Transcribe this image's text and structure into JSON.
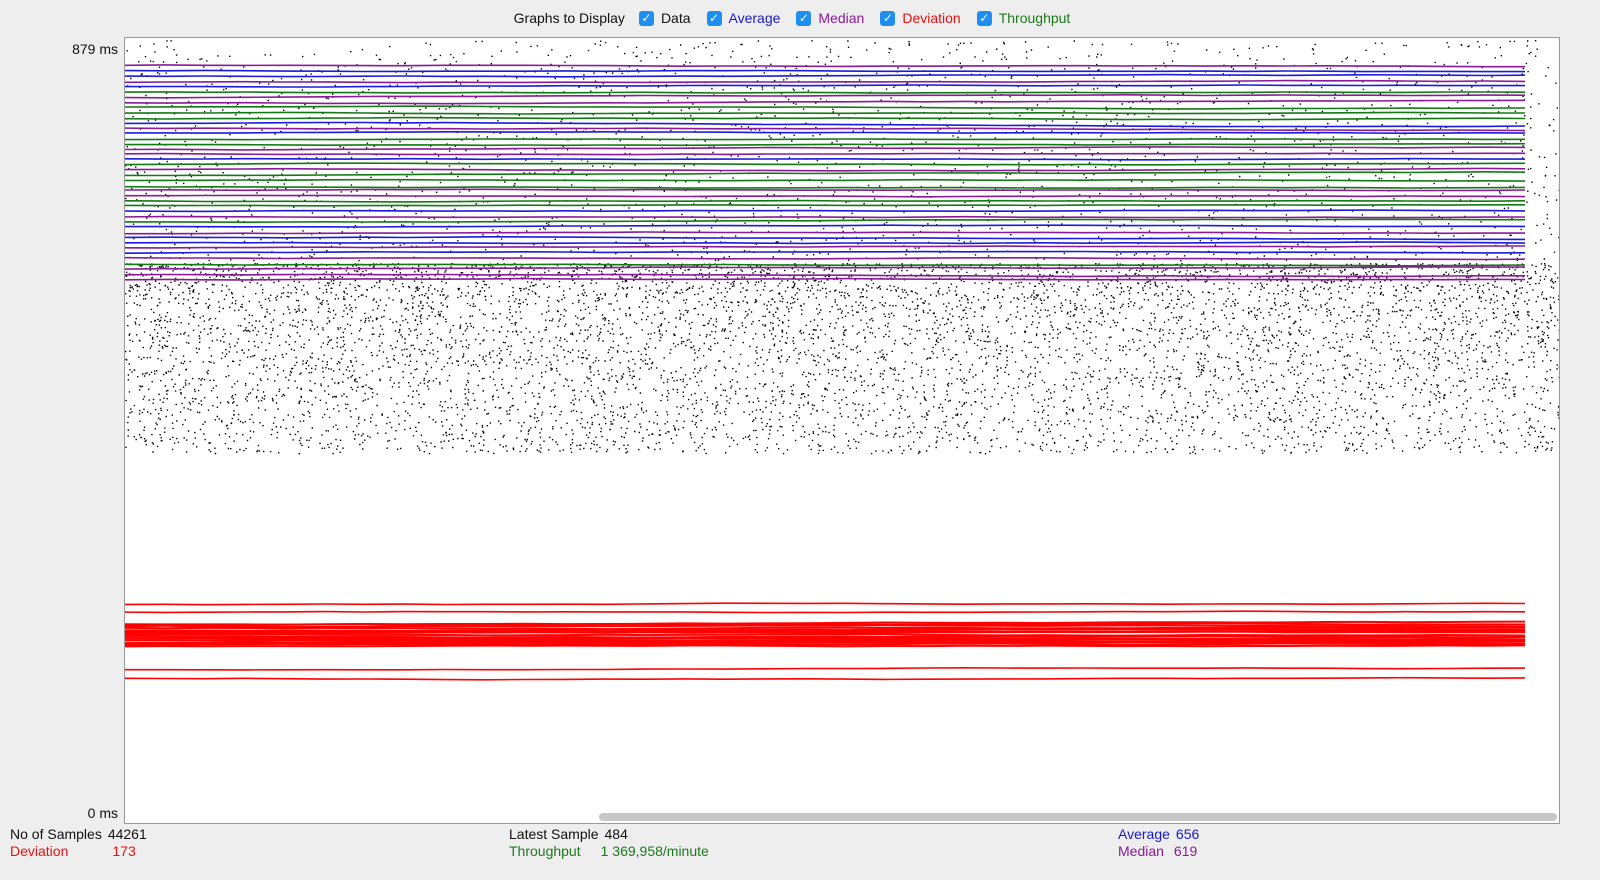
{
  "toolbar": {
    "title": "Graphs to Display",
    "options": [
      {
        "label": "Data",
        "checked": true,
        "color": "#111111"
      },
      {
        "label": "Average",
        "checked": true,
        "color": "#1a1acc"
      },
      {
        "label": "Median",
        "checked": true,
        "color": "#8a1a9a"
      },
      {
        "label": "Deviation",
        "checked": true,
        "color": "#e81010"
      },
      {
        "label": "Throughput",
        "checked": true,
        "color": "#1b7a1b"
      }
    ]
  },
  "axis": {
    "y_max_label": "879 ms",
    "y_min_label": "0 ms",
    "y_max": 879,
    "y_min": 0
  },
  "stats": {
    "samples_label": "No of Samples",
    "samples_value": "44261",
    "deviation_label": "Deviation",
    "deviation_value": "173",
    "latest_label": "Latest Sample",
    "latest_value": "484",
    "throughput_label": "Throughput",
    "throughput_value": "1 369,958/minute",
    "average_label": "Average",
    "average_value": "656",
    "median_label": "Median",
    "median_value": "619"
  },
  "colors": {
    "data": "#000000",
    "average": "#1a1ae0",
    "median": "#8a1a9a",
    "deviation": "#ff0000",
    "throughput": "#127a12",
    "check": "#1e8ef0"
  }
}
